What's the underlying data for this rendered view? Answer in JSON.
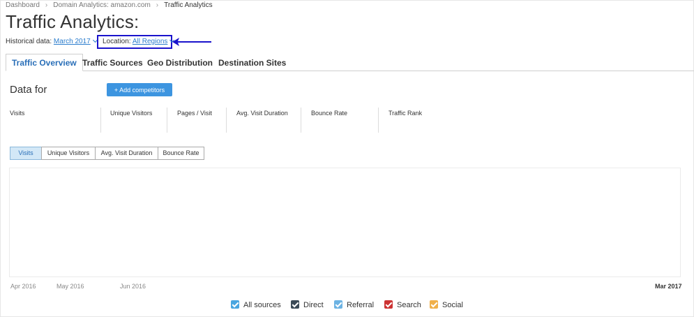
{
  "breadcrumb": [
    "Dashboard",
    "Domain Analytics: amazon.com",
    "Traffic Analytics"
  ],
  "page_title": "Traffic Analytics:",
  "filters": {
    "historical_label": "Historical data:",
    "historical_value": "March 2017",
    "location_label": "Location:",
    "location_value": "All Regions"
  },
  "tabs": [
    {
      "label": "Traffic Overview",
      "active": true
    },
    {
      "label": "Traffic Sources",
      "active": false
    },
    {
      "label": "Geo Distribution",
      "active": false
    },
    {
      "label": "Destination Sites",
      "active": false
    }
  ],
  "data_for_label": "Data for",
  "add_competitors_label": "+  Add competitors",
  "metrics": [
    "Visits",
    "Unique Visitors",
    "Pages / Visit",
    "Avg. Visit Duration",
    "Bounce Rate",
    "Traffic Rank"
  ],
  "chart_toggles": [
    {
      "label": "Visits",
      "active": true
    },
    {
      "label": "Unique Visitors",
      "active": false
    },
    {
      "label": "Avg. Visit Duration",
      "active": false
    },
    {
      "label": "Bounce Rate",
      "active": false
    }
  ],
  "x_axis_ticks": [
    "Apr 2016",
    "May 2016",
    "Jun 2016",
    "Mar 2017"
  ],
  "legend": [
    {
      "label": "All sources",
      "color": "#4aa6e0",
      "icon": "checkbox-checked-icon"
    },
    {
      "label": "Direct",
      "color": "#3b4a57",
      "icon": "checkbox-checked-icon"
    },
    {
      "label": "Referral",
      "color": "#6db3e3",
      "icon": "checkbox-checked-icon"
    },
    {
      "label": "Search",
      "color": "#cc3333",
      "icon": "checkbox-checked-icon"
    },
    {
      "label": "Social",
      "color": "#f0b04a",
      "icon": "checkbox-checked-icon"
    }
  ],
  "colors": {
    "accent": "#2a7ccd",
    "annotation": "#1a13cc",
    "button": "#3d95e0"
  }
}
